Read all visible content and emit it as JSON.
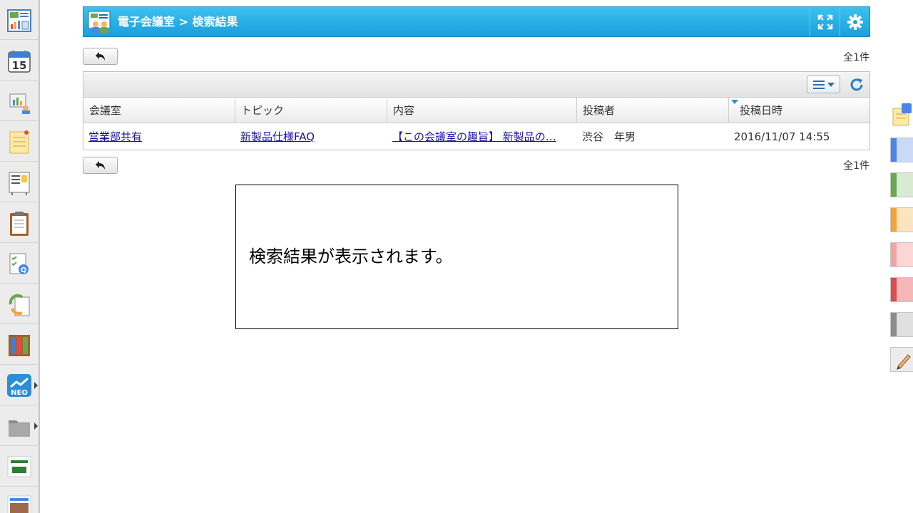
{
  "header": {
    "title": "電子会議室 > 検索結果",
    "expand_icon": "expand-icon",
    "settings_icon": "gear-icon"
  },
  "top_count": "全1件",
  "bottom_count": "全1件",
  "back_icon": "back-arrow-icon",
  "table": {
    "columns": [
      "会議室",
      "トピック",
      "内容",
      "投稿者",
      "投稿日時"
    ],
    "sorted_column": "投稿日時",
    "rows": [
      {
        "room": "営業部共有",
        "topic": "新製品仕様FAQ",
        "content": "【この会議室の趣旨】 新製品の…",
        "poster": "渋谷　年男",
        "datetime": "2016/11/07 14:55"
      }
    ]
  },
  "callout_text": "検索結果が表示されます。",
  "sidebar": {
    "items": [
      {
        "icon": "portal-icon"
      },
      {
        "icon": "calendar-icon",
        "label": "15"
      },
      {
        "icon": "facility-icon"
      },
      {
        "icon": "memo-icon"
      },
      {
        "icon": "bulletin-board-icon"
      },
      {
        "icon": "clipboard-icon"
      },
      {
        "icon": "survey-icon"
      },
      {
        "icon": "workflow-icon"
      },
      {
        "icon": "cabinet-icon"
      },
      {
        "icon": "neo-app-icon",
        "label": "NEO"
      },
      {
        "icon": "folder-icon"
      },
      {
        "icon": "tanomail-icon"
      },
      {
        "icon": "banner-icon"
      }
    ]
  },
  "colors": {
    "header_top": "#3cc1ef",
    "header_bottom": "#1a9fdc",
    "link": "#1a0dab",
    "palette": [
      "#4a86e8",
      "#6aa84f",
      "#f6a234",
      "#f4a3a3",
      "#e24b4b",
      "#8c8c8c"
    ]
  }
}
